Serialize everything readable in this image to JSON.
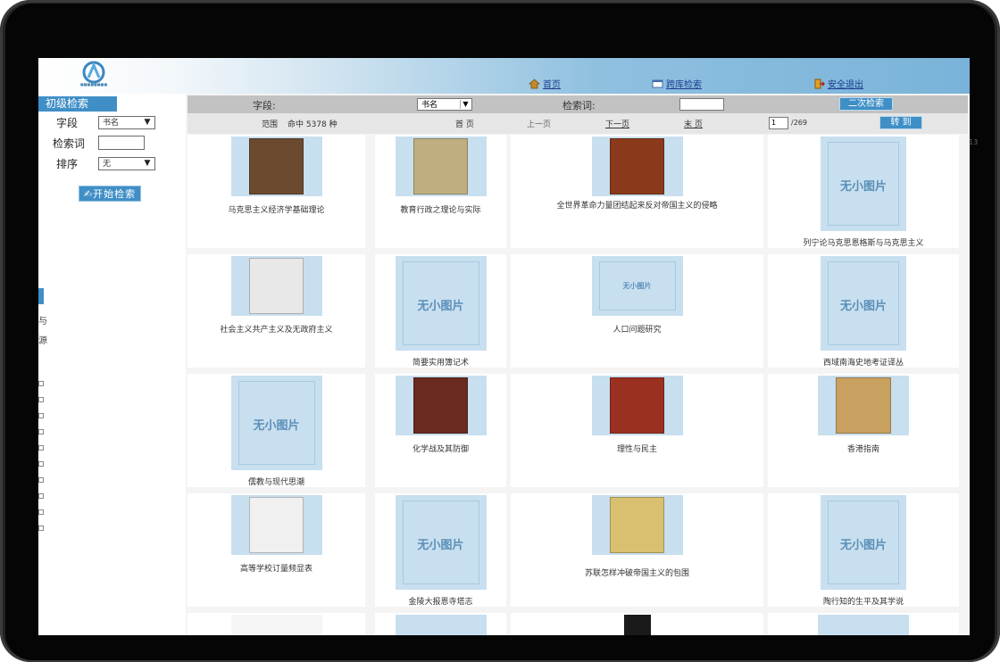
{
  "header": {
    "nav": [
      {
        "label": "首页",
        "icon": "home-icon"
      },
      {
        "label": "跨库检索",
        "icon": "search-window-icon"
      },
      {
        "label": "安全退出",
        "icon": "exit-icon"
      }
    ]
  },
  "sidebar": {
    "title": "初级检索",
    "field_label": "字段",
    "field_value": "书名",
    "keyword_label": "检索词",
    "keyword_value": "",
    "sort_label": "排序",
    "sort_value": "无",
    "start_button": "开始检索",
    "side_marks": [
      "与",
      "源"
    ]
  },
  "toolbar": {
    "field_label": "字段:",
    "field_value": "书名",
    "keyword_label": "检索词:",
    "keyword_value": "",
    "second_search": "二次检索"
  },
  "pager": {
    "scope": "范围",
    "hits": "命中 5378 种",
    "first": "首 页",
    "prev": "上一页",
    "next": "下一页",
    "last": "末 页",
    "page_value": "1",
    "total": "/269",
    "go": "转 到"
  },
  "placeholder_text": "无小图片",
  "books": [
    {
      "title": "马克思主义经济学基础理论",
      "has_cover": true
    },
    {
      "title": "教育行政之理论与实际",
      "has_cover": true
    },
    {
      "title": "全世界革命力量团结起来反对帝国主义的侵略",
      "has_cover": true
    },
    {
      "title": "列宁论马克思恩格斯与马克思主义",
      "has_cover": false
    },
    {
      "title": "社会主义共产主义及无政府主义",
      "has_cover": true
    },
    {
      "title": "简要实用簿记术",
      "has_cover": false
    },
    {
      "title": "人口问题研究",
      "has_cover": false
    },
    {
      "title": "西域南海史地考证译丛",
      "has_cover": false
    },
    {
      "title": "儒教与现代思潮",
      "has_cover": false
    },
    {
      "title": "化学战及其防御",
      "has_cover": true
    },
    {
      "title": "理性与民主",
      "has_cover": true
    },
    {
      "title": "香港指南",
      "has_cover": true
    },
    {
      "title": "高等学校订量频显表",
      "has_cover": true
    },
    {
      "title": "金陵大报恩寺塔志",
      "has_cover": false
    },
    {
      "title": "苏联怎样冲破帝国主义的包围",
      "has_cover": true
    },
    {
      "title": "陶行知的生平及其学说",
      "has_cover": false
    }
  ],
  "colors": {
    "accent": "#3f8fc6",
    "placeholder": "#c8dfef"
  },
  "side_number": "13"
}
